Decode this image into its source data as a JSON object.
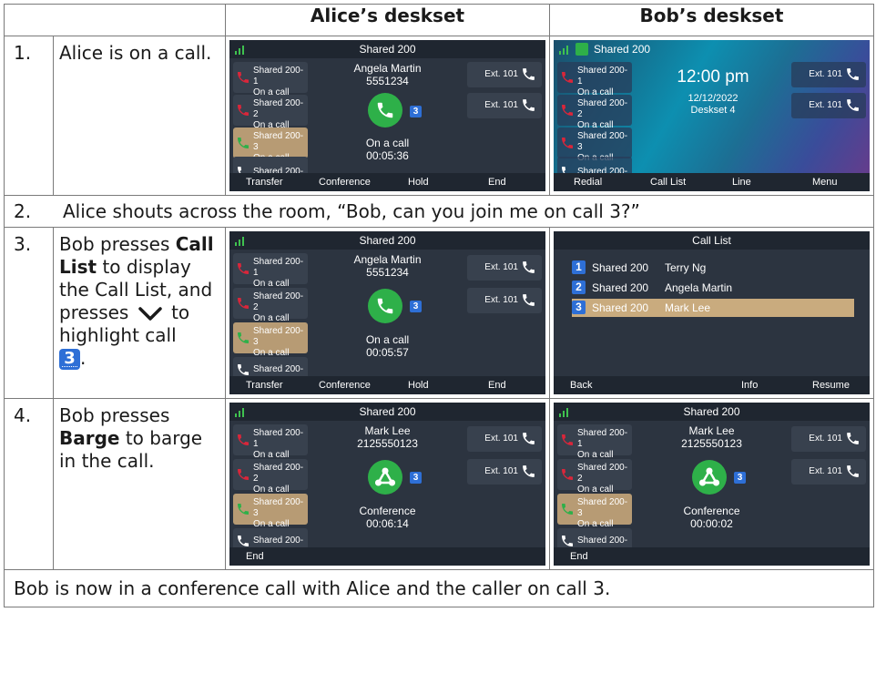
{
  "headers": {
    "alice": "Alice’s deskset",
    "bob": "Bob’s deskset"
  },
  "rows": [
    {
      "num": "1.",
      "desc": "Alice is on a call."
    },
    {
      "num": "2.",
      "desc": "Alice shouts across the room, “Bob, can you join me on call 3?”"
    },
    {
      "num": "3.",
      "desc_a": "Bob presses",
      "desc_b": "Call List",
      "desc_c": "to display the Call List, and presses",
      "desc_d": "to highlight call",
      "desc_e": "."
    },
    {
      "num": "4.",
      "desc_a": "Bob presses",
      "desc_b": "Barge",
      "desc_c": "to barge in the call."
    }
  ],
  "footer": "Bob is now in a conference call with Alice and the caller on call 3.",
  "badge_label": "3",
  "screen_common": {
    "title": "Shared 200",
    "lines": [
      {
        "name": "Shared 200-1",
        "state": "On a call"
      },
      {
        "name": "Shared 200-2",
        "state": "On a call"
      },
      {
        "name": "Shared 200-3",
        "state": "On a call"
      },
      {
        "name": "Shared 200-4",
        "state": ""
      }
    ],
    "ext1": "Ext. 101",
    "ext2": "Ext. 101",
    "badge": "3"
  },
  "s1a": {
    "caller": "Angela Martin",
    "number": "5551234",
    "status": "On a call",
    "timer": "00:05:36",
    "softkeys": [
      "Transfer",
      "Conference",
      "Hold",
      "End"
    ]
  },
  "s1b": {
    "time": "12:00 pm",
    "date": "12/12/2022",
    "deskset": "Deskset 4",
    "softkeys": [
      "Redial",
      "Call List",
      "Line",
      "Menu"
    ]
  },
  "s3a": {
    "caller": "Angela Martin",
    "number": "5551234",
    "status": "On a call",
    "timer": "00:05:57",
    "softkeys": [
      "Transfer",
      "Conference",
      "Hold",
      "End"
    ]
  },
  "s3b": {
    "title": "Call List",
    "items": [
      {
        "num": "1",
        "line": "Shared 200",
        "name": "Terry Ng"
      },
      {
        "num": "2",
        "line": "Shared 200",
        "name": "Angela Martin"
      },
      {
        "num": "3",
        "line": "Shared 200",
        "name": "Mark Lee"
      }
    ],
    "softkeys": [
      "Back",
      "Info",
      "Resume"
    ]
  },
  "s4a": {
    "caller": "Mark Lee",
    "number": "2125550123",
    "status": "Conference",
    "timer": "00:06:14",
    "softkeys": [
      "End"
    ]
  },
  "s4b": {
    "caller": "Mark Lee",
    "number": "2125550123",
    "status": "Conference",
    "timer": "00:00:02",
    "softkeys": [
      "End"
    ]
  },
  "colors": {
    "active_line": "#b79b74",
    "call_green": "#2eb049",
    "badge_blue": "#2e6fd6",
    "busy_red": "#d9263a",
    "idle_white": "#ffffff"
  }
}
